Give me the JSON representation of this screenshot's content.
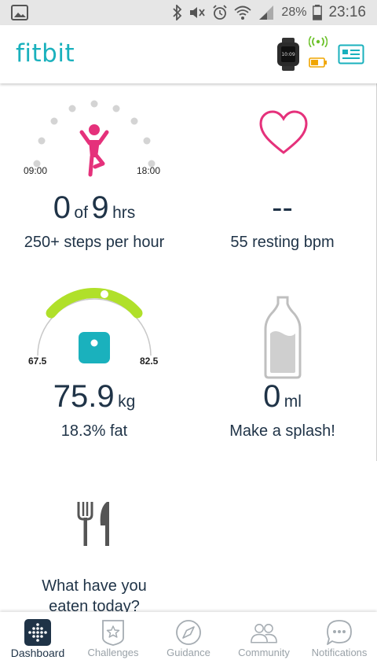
{
  "statusbar": {
    "battery_percent": "28%",
    "time": "23:16"
  },
  "header": {
    "logo": "fitbit"
  },
  "tiles": {
    "hourly": {
      "start_label": "09:00",
      "end_label": "18:00",
      "value": "0",
      "of": "of",
      "goal": "9",
      "unit": "hrs",
      "subtitle": "250+ steps per hour",
      "hours_completed": 0,
      "hours_goal": 9
    },
    "heart": {
      "value": "--",
      "subtitle": "55 resting bpm"
    },
    "weight": {
      "min_label": "67.5",
      "max_label": "82.5",
      "value": "75.9",
      "unit": "kg",
      "subtitle": "18.3% fat"
    },
    "water": {
      "value": "0",
      "unit": "ml",
      "subtitle": "Make a splash!"
    },
    "food": {
      "line1": "What have you",
      "line2": "eaten today?"
    }
  },
  "bottom_nav": {
    "items": [
      {
        "label": "Dashboard",
        "icon": "dashboard-icon",
        "active": true
      },
      {
        "label": "Challenges",
        "icon": "challenges-icon",
        "active": false
      },
      {
        "label": "Guidance",
        "icon": "compass-icon",
        "active": false
      },
      {
        "label": "Community",
        "icon": "community-icon",
        "active": false
      },
      {
        "label": "Notifications",
        "icon": "notifications-icon",
        "active": false
      }
    ]
  },
  "colors": {
    "brand": "#1ab1bd",
    "heart": "#e5317b",
    "gauge": "#b0e02a",
    "text": "#1f3347",
    "water_fill": "#cfcfcf"
  }
}
